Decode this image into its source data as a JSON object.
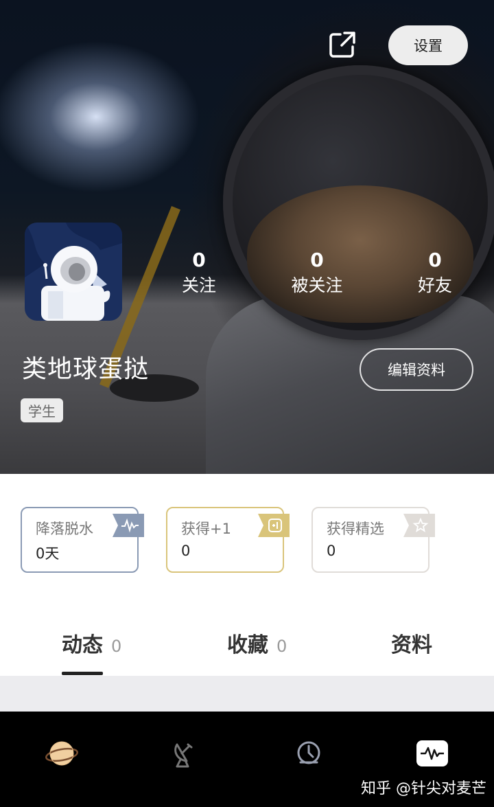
{
  "header": {
    "settings_label": "设置"
  },
  "profile": {
    "username": "类地球蛋挞",
    "tag": "学生",
    "edit_label": "编辑资料",
    "stats": [
      {
        "value": "0",
        "label": "关注"
      },
      {
        "value": "0",
        "label": "被关注"
      },
      {
        "value": "0",
        "label": "好友"
      }
    ]
  },
  "cards": [
    {
      "title": "降落脱水",
      "value": "0天",
      "color": "#8a9ab4"
    },
    {
      "title": "获得+1",
      "value": "0",
      "color": "#d9c47a"
    },
    {
      "title": "获得精选",
      "value": "0",
      "color": "#e0dcd8"
    }
  ],
  "tabs": [
    {
      "label": "动态",
      "count": "0"
    },
    {
      "label": "收藏",
      "count": "0"
    },
    {
      "label": "资料",
      "count": ""
    }
  ],
  "bottom_nav": [
    {
      "icon": "planet-icon"
    },
    {
      "icon": "satellite-dish-icon"
    },
    {
      "icon": "astronaut-helmet-icon"
    },
    {
      "icon": "waveform-icon"
    }
  ],
  "watermark": "知乎 @针尖对麦芒"
}
